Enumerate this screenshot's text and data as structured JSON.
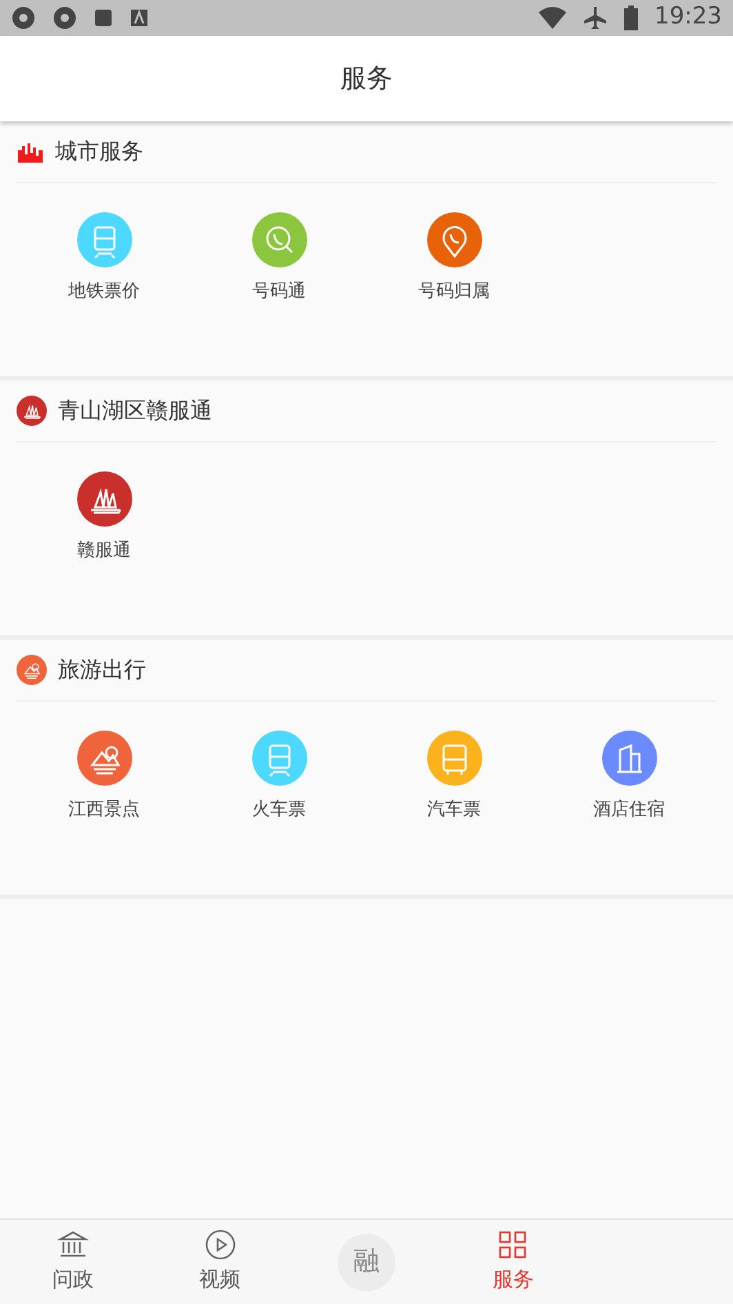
{
  "status_bar": {
    "time": "19:23"
  },
  "header": {
    "title": "服务"
  },
  "sections": [
    {
      "title": "城市服务",
      "items": [
        {
          "label": "地铁票价",
          "color": "#4dd9ff"
        },
        {
          "label": "号码通",
          "color": "#8cc63f"
        },
        {
          "label": "号码归属",
          "color": "#e8620a"
        }
      ]
    },
    {
      "title": "青山湖区赣服通",
      "items": [
        {
          "label": "赣服通",
          "color": "#c9302c"
        }
      ]
    },
    {
      "title": "旅游出行",
      "items": [
        {
          "label": "江西景点",
          "color": "#f0643c"
        },
        {
          "label": "火车票",
          "color": "#4dd9ff"
        },
        {
          "label": "汽车票",
          "color": "#fbb21c"
        },
        {
          "label": "酒店住宿",
          "color": "#6b8afd"
        }
      ]
    }
  ],
  "bottom_nav": [
    {
      "kind": "tab",
      "label": "问政",
      "selected": false
    },
    {
      "kind": "tab",
      "label": "视频",
      "selected": false
    },
    {
      "kind": "center",
      "label": "融",
      "selected": false
    },
    {
      "kind": "tab",
      "label": "服务",
      "selected": true
    }
  ]
}
